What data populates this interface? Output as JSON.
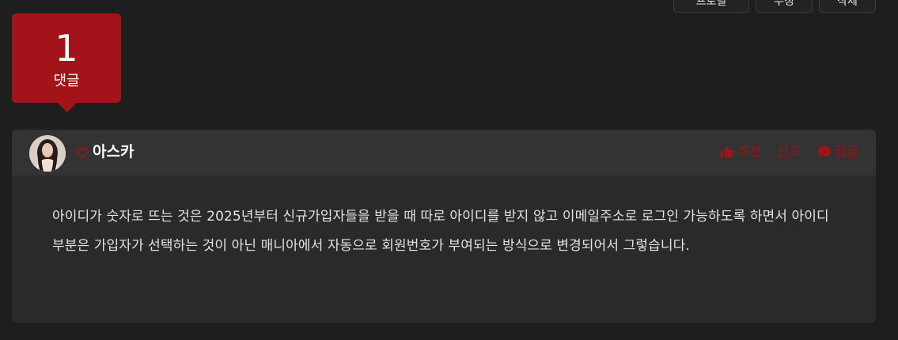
{
  "top_buttons": [
    {
      "label": "프로필"
    },
    {
      "label": "수정"
    },
    {
      "label": "삭제"
    }
  ],
  "badge": {
    "count": "1",
    "label": "댓글"
  },
  "comment": {
    "author": "아스카",
    "actions": {
      "recommend": "추천",
      "report": "신고",
      "reply": "답글"
    },
    "body": "아이디가 숫자로 뜨는 것은 2025년부터 신규가입자들을 받을 때 따로 아이디를 받지 않고 이메일주소로 로그인 가능하도록 하면서 아이디 부분은 가입자가 선택하는 것이 아닌 매니아에서 자동으로 회원번호가 부여되는 방식으로 변경되어서 그렇습니다."
  },
  "colors": {
    "background": "#1e1e1e",
    "badge": "#a3131a",
    "card": "#2a2a2a",
    "card_header": "#333333",
    "action_accent": "#9b1418"
  }
}
